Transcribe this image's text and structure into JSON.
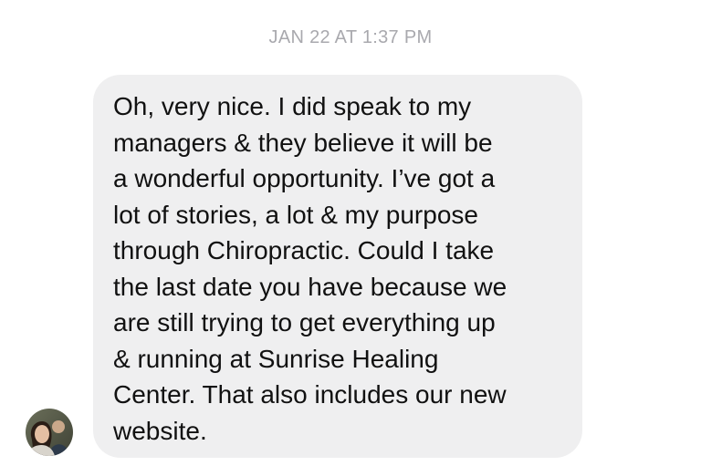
{
  "conversation": {
    "timestamp": "JAN 22 AT 1:37 PM",
    "message": {
      "lines": [
        "Oh, very nice. I did speak to my",
        "managers & they believe it will be",
        "a wonderful opportunity. I’ve got a",
        "lot of stories, a lot & my purpose",
        "through Chiropractic. Could I take",
        "the last date you have because we",
        "are still trying to get everything up",
        "& running at Sunrise Healing",
        "Center. That also includes our new",
        "website."
      ]
    },
    "sender_avatar": "profile-photo"
  }
}
